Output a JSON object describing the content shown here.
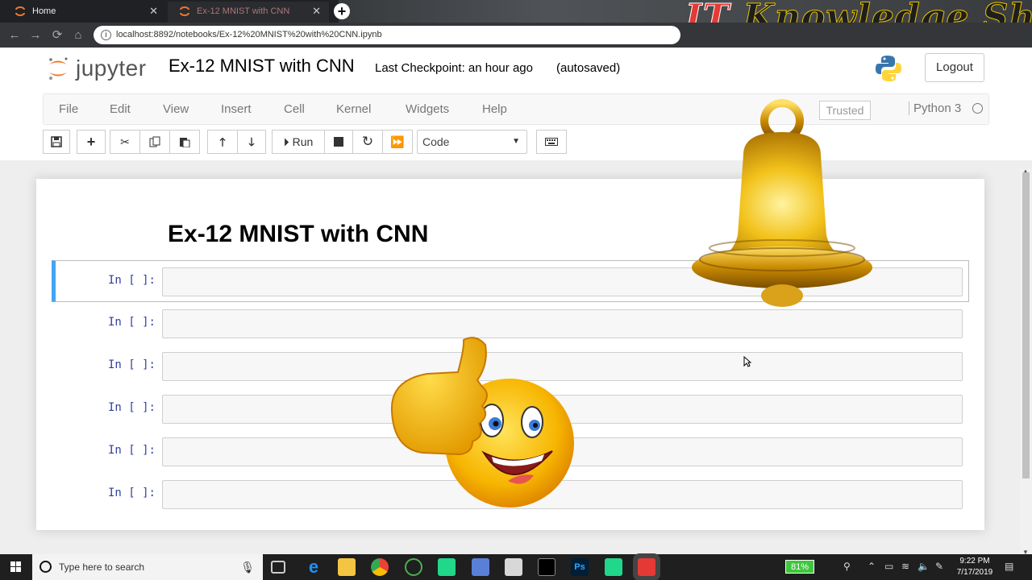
{
  "browser": {
    "tabs": [
      {
        "title": "Home"
      },
      {
        "title": "Ex-12 MNIST with CNN"
      }
    ],
    "url": "localhost:8892/notebooks/Ex-12%20MNIST%20with%20CNN.ipynb",
    "banner_it": "IT",
    "banner_text": "Knowledge Shelf"
  },
  "jupyter": {
    "logo_word": "jupyter",
    "notebook_name": "Ex-12 MNIST with CNN",
    "checkpoint": "Last Checkpoint: an hour ago",
    "autosave": "(autosaved)",
    "logout": "Logout",
    "menu": [
      "File",
      "Edit",
      "View",
      "Insert",
      "Cell",
      "Kernel",
      "Widgets",
      "Help"
    ],
    "trusted": "Trusted",
    "kernel": "Python 3",
    "run_label": "Run",
    "cell_type": "Code"
  },
  "notebook": {
    "heading": "Ex-12 MNIST with CNN",
    "cells": [
      {
        "prompt": "In [ ]:",
        "selected": true
      },
      {
        "prompt": "In [ ]:"
      },
      {
        "prompt": "In [ ]:"
      },
      {
        "prompt": "In [ ]:"
      },
      {
        "prompt": "In [ ]:"
      },
      {
        "prompt": "In [ ]:"
      }
    ]
  },
  "taskbar": {
    "search_placeholder": "Type here to search",
    "battery": "81%",
    "time": "9:22 PM",
    "date": "7/17/2019"
  },
  "colors": {
    "accent_selected_cell": "#42a5f5",
    "prompt": "#303f9f",
    "banner_it": "#e53935"
  }
}
